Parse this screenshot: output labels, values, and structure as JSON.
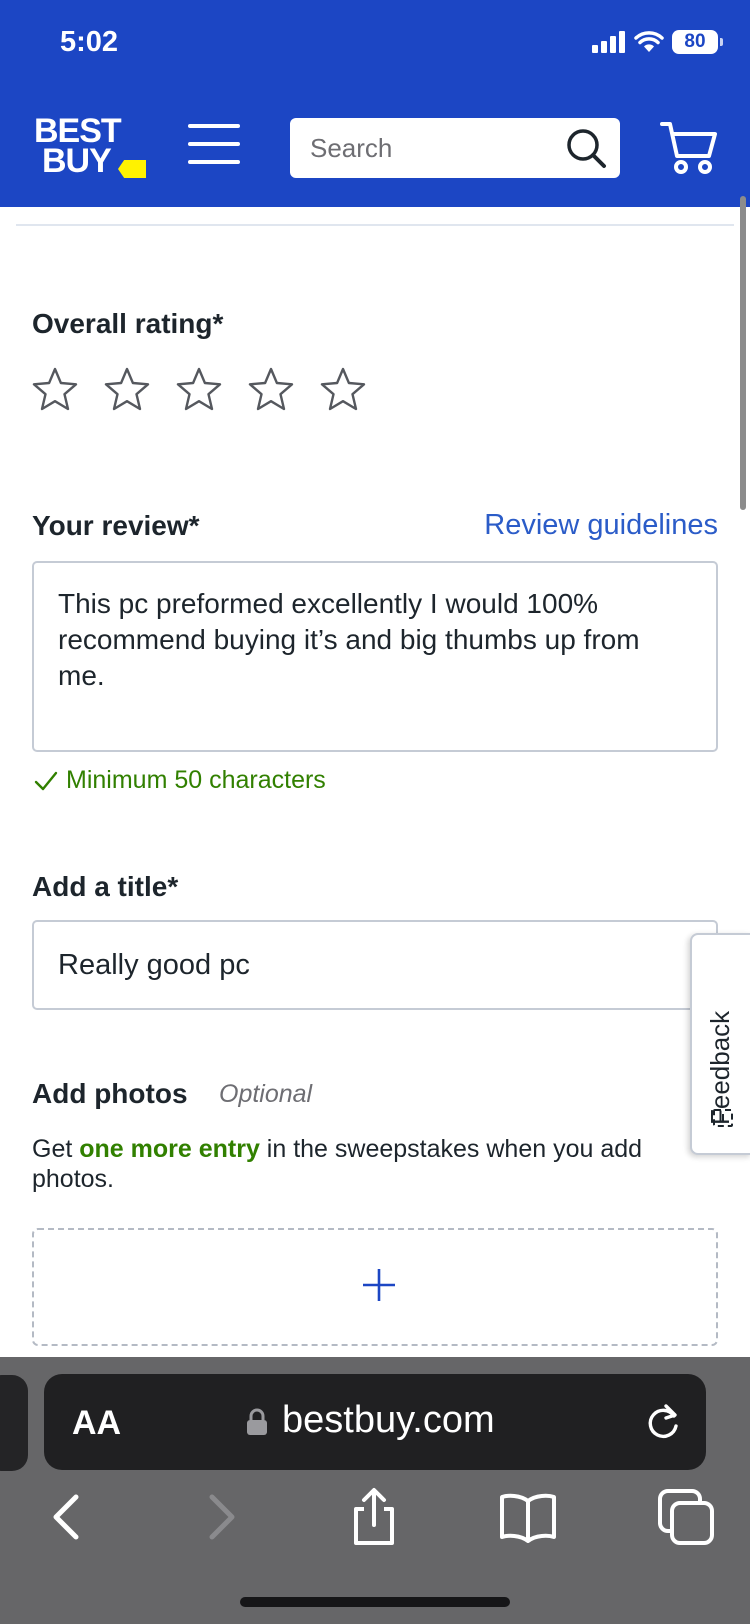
{
  "status_bar": {
    "time": "5:02",
    "battery": "80"
  },
  "header": {
    "logo_line1": "BEST",
    "logo_line2": "BUY",
    "search_placeholder": "Search"
  },
  "form": {
    "rating": {
      "label": "Overall rating*",
      "stars_total": 5,
      "stars_selected": 0
    },
    "review": {
      "label": "Your review*",
      "guidelines_link": "Review guidelines",
      "value": "This pc preformed excellently I would 100% recommend buying it’s and big thumbs up from me.",
      "hint": "Minimum 50 characters"
    },
    "title": {
      "label": "Add a title*",
      "value": "Really good pc"
    },
    "photos": {
      "label": "Add photos",
      "optional": "Optional",
      "promo_before": "Get ",
      "promo_highlight": "one more entry",
      "promo_after": " in the sweepstakes when you add photos."
    },
    "feedback_tab": "Feedback"
  },
  "browser": {
    "text_size_button": "AA",
    "url": "bestbuy.com"
  },
  "colors": {
    "brand_blue": "#1c46c4",
    "brand_yellow": "#fff200",
    "link_blue": "#2b5cc8",
    "success_green": "#318000"
  }
}
